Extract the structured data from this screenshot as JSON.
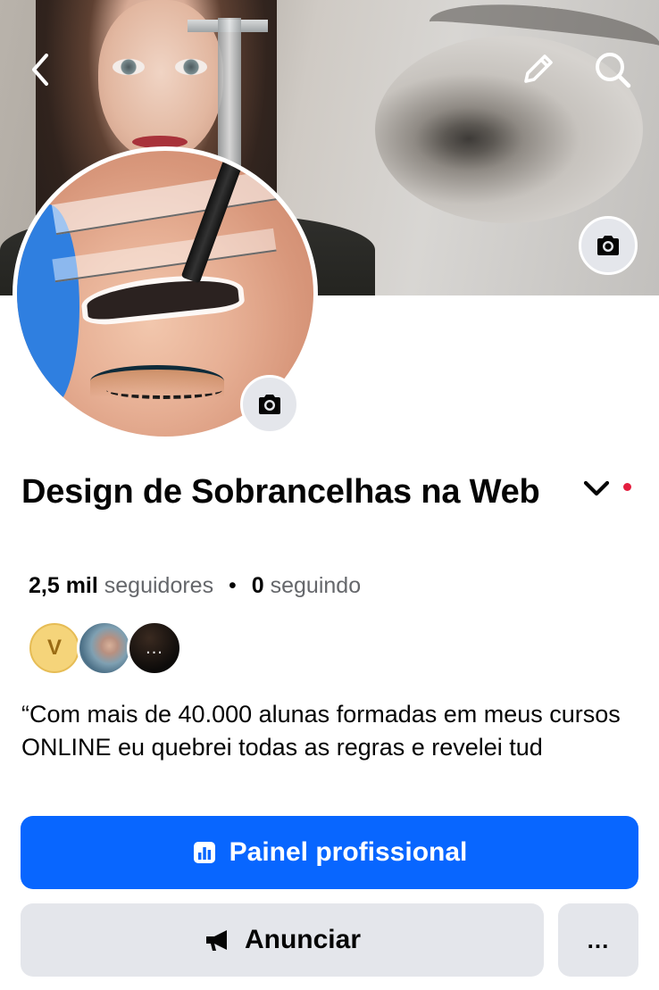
{
  "header": {
    "back_icon": "chevron-left-icon",
    "edit_icon": "pencil-icon",
    "search_icon": "search-icon"
  },
  "cover": {
    "camera_icon": "camera-icon"
  },
  "profile": {
    "camera_icon": "camera-icon",
    "name": "Design de Sobrancelhas na Web",
    "dropdown_icon": "chevron-down-icon",
    "notification_dot_color": "#e41e3f"
  },
  "stats": {
    "followers_count": "2,5 mil",
    "followers_label": "seguidores",
    "separator": "•",
    "following_count": "0",
    "following_label": "seguindo"
  },
  "followers_preview": {
    "first_initial": "V",
    "more_label": "..."
  },
  "bio": {
    "text": "“Com mais de 40.000 alunas formadas em meus cursos ONLINE eu quebrei todas as regras e revelei tud"
  },
  "actions": {
    "professional_panel_label": "Painel profissional",
    "professional_panel_icon": "dashboard-icon",
    "advertise_label": "Anunciar",
    "advertise_icon": "megaphone-icon",
    "more_label": "..."
  },
  "colors": {
    "primary": "#0866ff",
    "secondary_button": "#e4e6eb",
    "text_primary": "#050505",
    "text_secondary": "#65676b"
  }
}
